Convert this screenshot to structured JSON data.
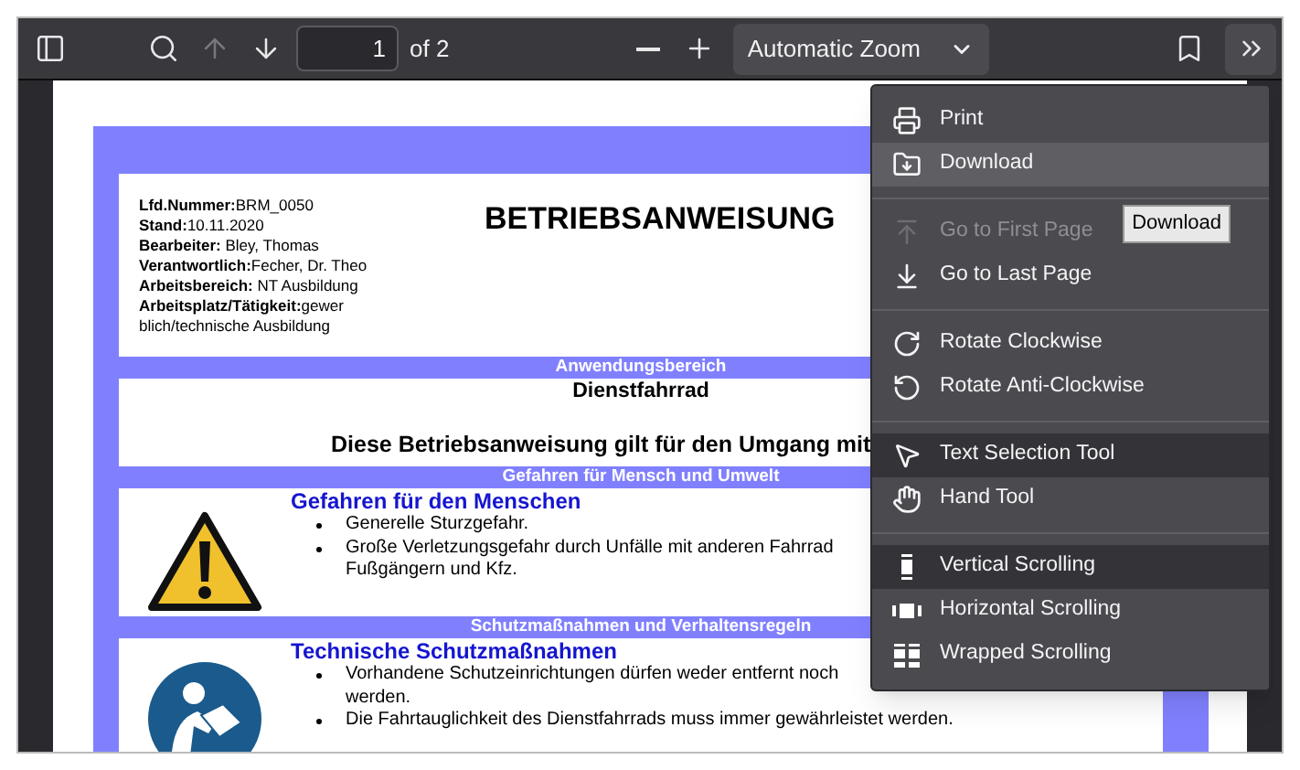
{
  "toolbar": {
    "buttons": [
      {
        "kind": "sidebar",
        "disabled": false,
        "selected": false
      },
      {
        "kind": "search",
        "disabled": false,
        "selected": false
      },
      {
        "kind": "previous",
        "disabled": true,
        "selected": false
      },
      {
        "kind": "next",
        "disabled": false,
        "selected": false
      }
    ],
    "page_input": {
      "value": "1"
    },
    "page_count": "of 2",
    "zoom_buttons": [
      {
        "kind": "zoom-out",
        "disabled": false,
        "selected": false
      },
      {
        "kind": "zoom-in",
        "disabled": false,
        "selected": false
      }
    ],
    "zoom_select": {
      "value": "Automatic Zoom"
    },
    "right_buttons": [
      {
        "kind": "bookmark",
        "disabled": false,
        "selected": false
      },
      {
        "kind": "tools",
        "disabled": false,
        "selected": true
      }
    ]
  },
  "document": {
    "info": [
      "**Lfd.Nummer:**BRM_0050",
      "**Stand:**10.11.2020",
      "**Bearbeiter:** Bley, Thomas",
      "**Verantwortlich:**Fecher, Dr. Theo",
      "**Arbeitsbereich:** NT Ausbildung",
      "**Arbeitsplatz/Tätigkeit:**gewer blich/technische Ausbildung"
    ],
    "title": "BETRIEBSANWEISUNG",
    "sections": [
      {
        "kind": "scope",
        "heading": "Anwendungsbereich",
        "subject": "Dienstfahrrad",
        "statement": "Diese Betriebsanweisung gilt für den Umgang mit"
      },
      {
        "kind": "hazard",
        "heading": "Gefahren für Mensch und Umwelt",
        "subtitle": "Gefahren für den Menschen",
        "bullets": [
          {
            "lines": [
              "Generelle Sturzgefahr."
            ]
          },
          {
            "lines": [
              "Große Verletzungsgefahr durch Unfälle mit anderen Fahrrad",
              "Fußgängern und Kfz."
            ]
          }
        ]
      },
      {
        "kind": "manual",
        "heading": "Schutzmaßnahmen und Verhaltensregeln",
        "subtitle": "Technische Schutzmaßnahmen",
        "bullets": [
          {
            "lines": [
              "Vorhandene Schutzeinrichtungen dürfen weder entfernt noch",
              "werden."
            ]
          },
          {
            "lines": [
              "Die Fahrtauglichkeit des Dienstfahrrads muss immer gewährleistet werden."
            ]
          }
        ]
      }
    ]
  },
  "menu": {
    "groups": [
      [
        {
          "kind": "print",
          "label": "Print",
          "highlighted": false,
          "selected": false,
          "disabled": false
        },
        {
          "kind": "download",
          "label": "Download",
          "highlighted": true,
          "selected": false,
          "disabled": false
        }
      ],
      [
        {
          "kind": "first",
          "label": "Go to First Page",
          "highlighted": false,
          "selected": false,
          "disabled": true
        },
        {
          "kind": "last",
          "label": "Go to Last Page",
          "highlighted": false,
          "selected": false,
          "disabled": false
        }
      ],
      [
        {
          "kind": "rotate-cw",
          "label": "Rotate Clockwise",
          "highlighted": false,
          "selected": false,
          "disabled": false
        },
        {
          "kind": "rotate-ccw",
          "label": "Rotate Anti-Clockwise",
          "highlighted": false,
          "selected": false,
          "disabled": false
        }
      ],
      [
        {
          "kind": "select",
          "label": "Text Selection Tool",
          "highlighted": false,
          "selected": true,
          "disabled": false
        },
        {
          "kind": "hand",
          "label": "Hand Tool",
          "highlighted": false,
          "selected": false,
          "disabled": false
        }
      ],
      [
        {
          "kind": "vertical",
          "label": "Vertical Scrolling",
          "highlighted": false,
          "selected": true,
          "disabled": false
        },
        {
          "kind": "horizontal",
          "label": "Horizontal Scrolling",
          "highlighted": false,
          "selected": false,
          "disabled": false
        },
        {
          "kind": "wrapped",
          "label": "Wrapped Scrolling",
          "highlighted": false,
          "selected": false,
          "disabled": false
        }
      ]
    ]
  },
  "tooltip": "Download"
}
